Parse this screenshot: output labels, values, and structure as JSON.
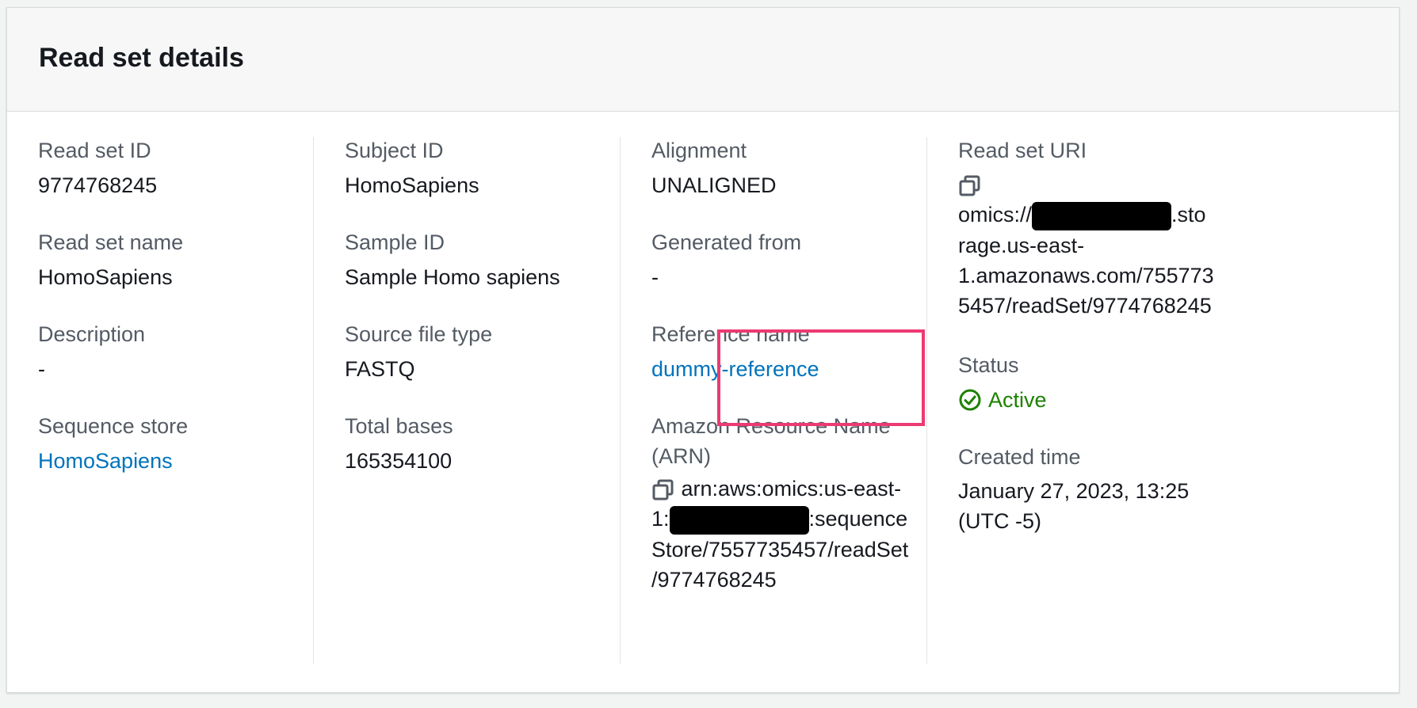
{
  "panel": {
    "title": "Read set details"
  },
  "col1": {
    "read_set_id": {
      "label": "Read set ID",
      "value": "9774768245"
    },
    "read_set_name": {
      "label": "Read set name",
      "value": "HomoSapiens"
    },
    "description": {
      "label": "Description",
      "value": "-"
    },
    "sequence_store": {
      "label": "Sequence store",
      "value": "HomoSapiens"
    }
  },
  "col2": {
    "subject_id": {
      "label": "Subject ID",
      "value": "HomoSapiens"
    },
    "sample_id": {
      "label": "Sample ID",
      "value": "Sample Homo sapiens"
    },
    "source_file_type": {
      "label": "Source file type",
      "value": "FASTQ"
    },
    "total_bases": {
      "label": "Total bases",
      "value": "165354100"
    }
  },
  "col3": {
    "alignment": {
      "label": "Alignment",
      "value": "UNALIGNED"
    },
    "generated_from": {
      "label": "Generated from",
      "value": "-"
    },
    "reference_name": {
      "label": "Reference name",
      "value": "dummy-reference"
    },
    "arn": {
      "label_line1": "Amazon Resource Name",
      "label_line2": "(ARN)",
      "line1": "arn:aws:omics:us-east-",
      "line2_prefix": "1:",
      "line2_suffix": ":sequence",
      "line3": "Store/7557735457/readSet",
      "line4": "/9774768245"
    }
  },
  "col4": {
    "read_set_uri": {
      "label": "Read set URI",
      "line1_prefix": "omics://",
      "line1_suffix": ".sto",
      "line2": "rage.us-east-",
      "line3": "1.amazonaws.com/755773",
      "line4": "5457/readSet/9774768245"
    },
    "status": {
      "label": "Status",
      "value": "Active"
    },
    "created_time": {
      "label": "Created time",
      "line1": "January 27, 2023, 13:25",
      "line2": "(UTC -5)"
    }
  },
  "icons": {
    "copy": "copy-icon",
    "status_ok": "check-circle-icon"
  },
  "colors": {
    "link": "#0073bb",
    "success": "#1d8102",
    "highlight": "#ec3a72"
  }
}
